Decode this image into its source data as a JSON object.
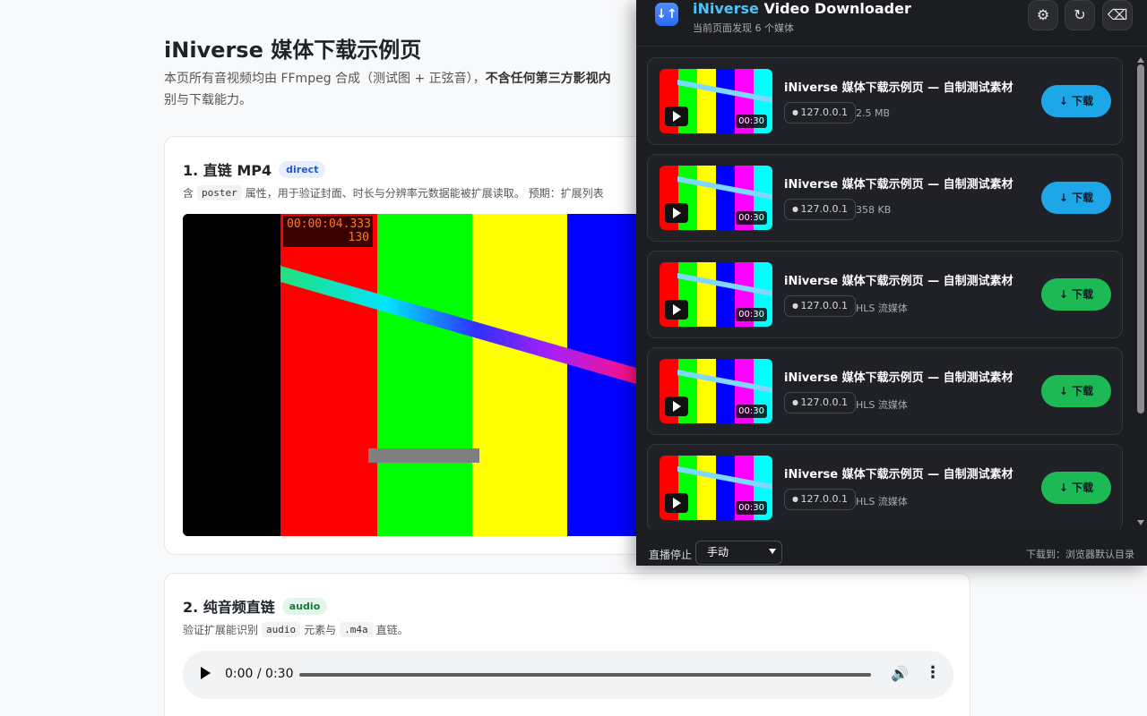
{
  "page": {
    "title": "iNiverse 媒体下载示例页",
    "intro_plain": "本页所有音视频均由 FFmpeg 合成（测试图 + 正弦音），",
    "intro_bold": "不含任何第三方影视内",
    "intro_tail": "别与下载能力。"
  },
  "card1": {
    "heading": "1. 直链 MP4",
    "badge": "direct",
    "desc_pre": "含",
    "desc_code": "poster",
    "desc_post": "属性，用于验证封面、时长与分辨率元数据能被扩展读取。 预期：扩展列表",
    "video": {
      "timecode": "00:00:04.333",
      "frame": "130"
    }
  },
  "card2": {
    "heading": "2. 纯音频直链",
    "badge": "audio",
    "desc_pre": "验证扩展能识别",
    "desc_code1": "audio",
    "desc_mid": "元素与",
    "desc_code2": ".m4a",
    "desc_post": "直链。",
    "player_time": "0:00 / 0:30"
  },
  "panel": {
    "title_brand": "iNiverse",
    "title_rest": " Video Downloader",
    "subtitle": "当前页面发现 6 个媒体",
    "buttons": {
      "settings": "⚙",
      "refresh": "↻",
      "clear": "⌫"
    },
    "items": [
      {
        "title": "iNiverse 媒体下载示例页 — 自制测试素材",
        "host": "127.0.0.1",
        "size": "2.5 MB",
        "duration": "00:30",
        "download": "↓ 下载"
      },
      {
        "title": "iNiverse 媒体下载示例页 — 自制测试素材",
        "host": "127.0.0.1",
        "size": "358 KB",
        "duration": "00:30",
        "download": "↓ 下载"
      },
      {
        "title": "iNiverse 媒体下载示例页 — 自制测试素材",
        "host": "127.0.0.1",
        "size": "HLS 流媒体",
        "duration": "00:30",
        "download": "↓ 下载"
      },
      {
        "title": "iNiverse 媒体下载示例页 — 自制测试素材",
        "host": "127.0.0.1",
        "size": "HLS 流媒体",
        "duration": "00:30",
        "download": "↓ 下载"
      },
      {
        "title": "iNiverse 媒体下载示例页 — 自制测试素材",
        "host": "127.0.0.1",
        "size": "HLS 流媒体",
        "duration": "00:30",
        "download": "↓ 下载"
      }
    ],
    "footer": {
      "live_stop_label": "直播停止",
      "live_stop_value": "手动",
      "download_dest": "下载到：浏览器默认目录"
    }
  },
  "colors": {
    "accent_blue": "#1ea7e8",
    "accent_green": "#1db954",
    "brand": "#4fc3f7",
    "panel_bg": "#1c1d21"
  }
}
